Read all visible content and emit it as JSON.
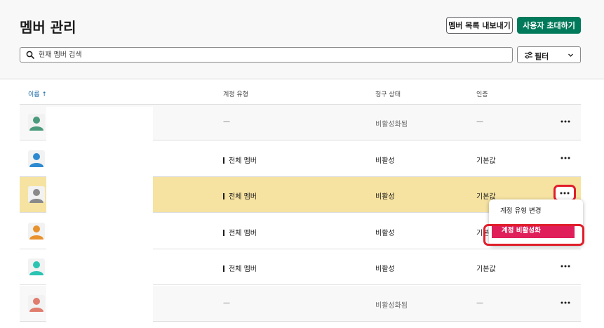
{
  "header": {
    "title": "멤버 관리",
    "export_label": "멤버 목록 내보내기",
    "invite_label": "사용자 초대하기"
  },
  "search": {
    "placeholder": "현재 멤버 검색"
  },
  "filter": {
    "label": "필터"
  },
  "columns": {
    "name": "이름 ↑",
    "type": "계정 유형",
    "billing": "청구 상태",
    "auth": "인증"
  },
  "rows": [
    {
      "type": "—",
      "billing": "비활성화됨",
      "auth": "—",
      "inactive": true,
      "avatar_color": "#4b9a7b"
    },
    {
      "type": "전체 멤버",
      "billing": "비활성",
      "auth": "기본값",
      "avatar_color": "#2d8ad1"
    },
    {
      "type": "전체 멤버",
      "billing": "비활성",
      "auth": "기본값",
      "selected": true,
      "avatar_color": "#8a8a8a"
    },
    {
      "type": "전체 멤버",
      "billing": "비활성",
      "auth": "기본값",
      "avatar_color": "#e8912d"
    },
    {
      "type": "전체 멤버",
      "billing": "비활성",
      "auth": "기본값",
      "avatar_color": "#2bc4b3"
    },
    {
      "type": "—",
      "billing": "비활성화됨",
      "auth": "—",
      "inactive": true,
      "avatar_color": "#e07d6e"
    }
  ],
  "menu": {
    "change_type": "계정 유형 변경",
    "deactivate": "계정 비활성화"
  },
  "colors": {
    "primary": "#007a5a",
    "danger": "#e01e5a",
    "highlight": "#f6e3a1",
    "link": "#1264a3",
    "annotation": "#e01e2b"
  },
  "icons": {
    "search": "search-icon",
    "filter": "sliders-icon",
    "chevron": "chevron-down-icon",
    "more": "ellipsis-icon",
    "avatar": "person-icon"
  }
}
